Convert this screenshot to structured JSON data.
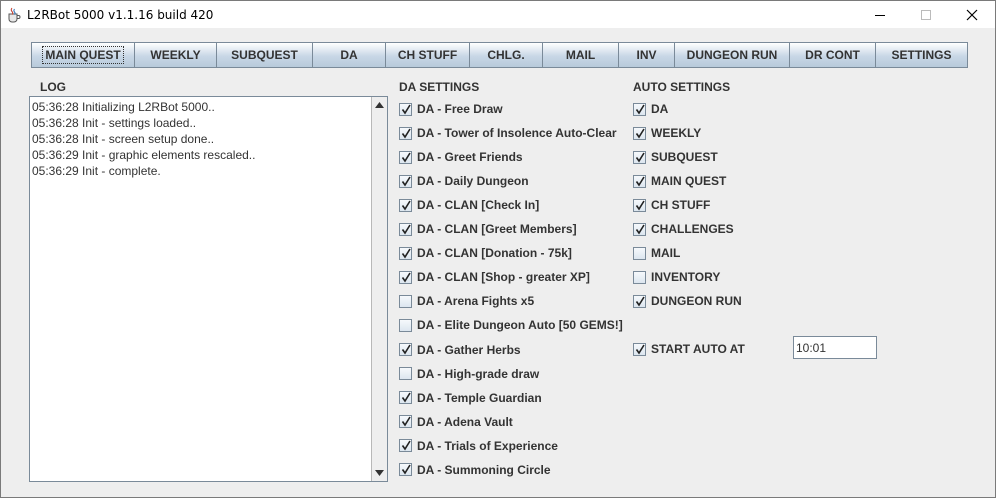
{
  "window": {
    "title": "L2RBot 5000 v1.1.16 build 420",
    "app_icon": "java-cup-icon",
    "controls": [
      "minimize-icon",
      "maximize-icon",
      "close-icon"
    ]
  },
  "tabs": [
    {
      "label": "MAIN QUEST",
      "active": true
    },
    {
      "label": "WEEKLY",
      "active": false
    },
    {
      "label": "SUBQUEST",
      "active": false
    },
    {
      "label": "DA",
      "active": false
    },
    {
      "label": "CH STUFF",
      "active": false
    },
    {
      "label": "CHLG.",
      "active": false
    },
    {
      "label": "MAIL",
      "active": false
    },
    {
      "label": "INV",
      "active": false
    },
    {
      "label": "DUNGEON RUN",
      "active": false
    },
    {
      "label": "DR CONT",
      "active": false
    },
    {
      "label": "SETTINGS",
      "active": false
    }
  ],
  "log": {
    "label": "LOG",
    "lines": [
      "05:36:28 Initializing L2RBot 5000..",
      "05:36:28 Init - settings loaded..",
      "05:36:28 Init - screen setup done..",
      "05:36:29 Init - graphic elements rescaled..",
      "05:36:29 Init - complete."
    ]
  },
  "da_settings": {
    "title": "DA SETTINGS",
    "items": [
      {
        "label": "DA - Free Draw",
        "checked": true
      },
      {
        "label": "DA - Tower of Insolence Auto-Clear",
        "checked": true
      },
      {
        "label": "DA - Greet Friends",
        "checked": true
      },
      {
        "label": "DA - Daily Dungeon",
        "checked": true
      },
      {
        "label": "DA - CLAN [Check In]",
        "checked": true
      },
      {
        "label": "DA - CLAN [Greet Members]",
        "checked": true
      },
      {
        "label": "DA - CLAN [Donation - 75k]",
        "checked": true
      },
      {
        "label": "DA - CLAN [Shop - greater XP]",
        "checked": true
      },
      {
        "label": "DA - Arena Fights x5",
        "checked": false
      },
      {
        "label": "DA - Elite Dungeon Auto [50 GEMS!]",
        "checked": false
      },
      {
        "label": "DA - Gather Herbs",
        "checked": true
      },
      {
        "label": "DA - High-grade draw",
        "checked": false
      },
      {
        "label": "DA - Temple Guardian",
        "checked": true
      },
      {
        "label": "DA - Adena Vault",
        "checked": true
      },
      {
        "label": "DA - Trials of Experience",
        "checked": true
      },
      {
        "label": "DA - Summoning Circle",
        "checked": true
      }
    ]
  },
  "auto_settings": {
    "title": "AUTO SETTINGS",
    "items": [
      {
        "label": "DA",
        "checked": true
      },
      {
        "label": "WEEKLY",
        "checked": true
      },
      {
        "label": "SUBQUEST",
        "checked": true
      },
      {
        "label": "MAIN QUEST",
        "checked": true
      },
      {
        "label": "CH STUFF",
        "checked": true
      },
      {
        "label": "CHALLENGES",
        "checked": true
      },
      {
        "label": "MAIL",
        "checked": false
      },
      {
        "label": "INVENTORY",
        "checked": false
      },
      {
        "label": "DUNGEON RUN",
        "checked": true
      }
    ],
    "start_auto": {
      "label": "START AUTO AT",
      "checked": true,
      "time": "10:01"
    }
  }
}
